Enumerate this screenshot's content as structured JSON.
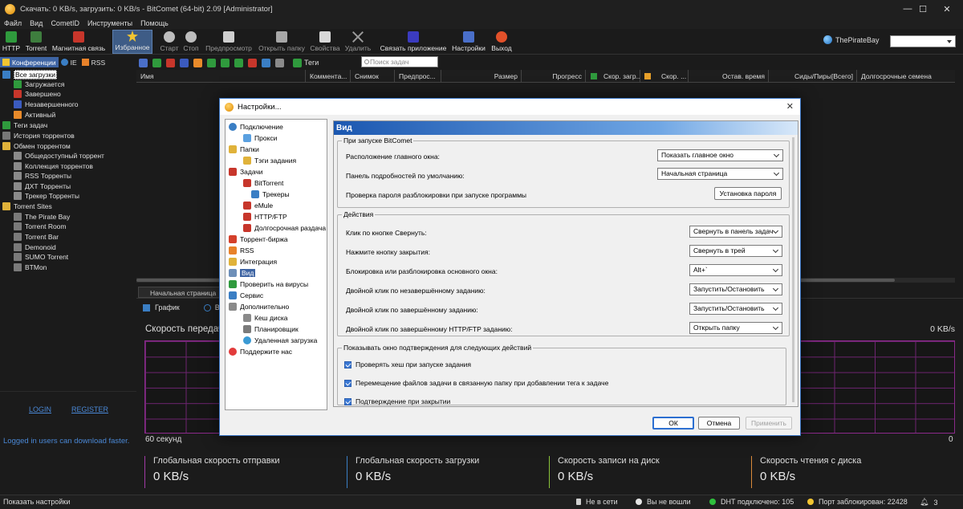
{
  "window": {
    "title": "Скачать: 0 KB/s, загрузить: 0 KB/s - BitComet (64-bit) 2.09 [Administrator]"
  },
  "menu": [
    "Файл",
    "Вид",
    "CometID",
    "Инструменты",
    "Помощь"
  ],
  "toolbar": {
    "http": "HTTP",
    "torrent": "Torrent",
    "magnet": "Магнитная связь",
    "favorites": "Избранное",
    "start": "Старт",
    "stop": "Стоп",
    "preview": "Предпросмотр",
    "open_folder": "Открыть папку",
    "properties": "Свойства",
    "delete": "Удалить",
    "link_app": "Связать приложение",
    "settings": "Настройки",
    "exit": "Выход",
    "site": "ThePirateBay"
  },
  "left_tabs": [
    "Конференции",
    "IE",
    "RSS"
  ],
  "tree": {
    "all": "Все загрузки",
    "downloading": "Загружается",
    "completed": "Завершено",
    "incomplete": "Незавершенного",
    "active": "Активный",
    "tags": "Теги задач",
    "history": "История торрентов",
    "exchange": "Обмен торрентом",
    "public": "Общедоступный торрент",
    "collection": "Коллекция торрентов",
    "rss": "RSS Торренты",
    "dht": "ДХТ Торренты",
    "tracker": "Трекер Торренты",
    "sites": "Torrent Sites",
    "piratebay": "The Pirate Bay",
    "room": "Torrent Room",
    "bar": "Torrent Bar",
    "demonoid": "Demonoid",
    "sumo": "SUMO Torrent",
    "btmon": "BTMon"
  },
  "left_bottom": {
    "login": "LOGIN",
    "register": "REGISTER",
    "note": "Logged in users can download faster."
  },
  "task_tools": {
    "tags": "Теги",
    "search_placeholder": "Поиск задач"
  },
  "columns": [
    "Имя",
    "Коммента...",
    "Снимок",
    "Предпрос...",
    "Размер",
    "Прогресс",
    "Скор. загр...",
    "Скор. ...",
    "Остав. время",
    "Сиды/Пиры[Всего]",
    "Долгосрочные семена"
  ],
  "bottom_tabs": {
    "start_page": "Начальная страница",
    "graph": "График",
    "b_label": "В"
  },
  "graph": {
    "speed_label": "Скорость передачи",
    "speed_value": "0 KB/s",
    "x_left": "60 секунд",
    "x_right": "0"
  },
  "stats": [
    {
      "label": "Глобальная скорость отправки",
      "value": "0 KB/s",
      "color": "#a13aa6"
    },
    {
      "label": "Глобальная скорость загрузки",
      "value": "0 KB/s",
      "color": "#3a7ec4"
    },
    {
      "label": "Скорость записи на диск",
      "value": "0 KB/s",
      "color": "#8ac43a"
    },
    {
      "label": "Скорость чтения с диска",
      "value": "0 KB/s",
      "color": "#d98a3a"
    }
  ],
  "statusbar": {
    "left": "Показать настройки",
    "network": "Не в сети",
    "login": "Вы не вошли",
    "dht": "DHT подключено: 105",
    "port": "Порт заблокирован: 22428",
    "notif": "3"
  },
  "dialog": {
    "title": "Настройки...",
    "nav": {
      "connection": "Подключение",
      "proxy": "Прокси",
      "folders": "Папки",
      "tag_tasks": "Тэги задания",
      "tasks": "Задачи",
      "bittorrent": "BitTorrent",
      "trackers": "Трекеры",
      "emule": "eMule",
      "httpftp": "HTTP/FTP",
      "longterm": "Долгосрочная раздача",
      "exchange": "Торрент-биржа",
      "rss": "RSS",
      "integration": "Интеграция",
      "view": "Вид",
      "virus": "Проверить на вирусы",
      "service": "Сервис",
      "advanced": "Дополнительно",
      "cache": "Кеш диска",
      "scheduler": "Планировщик",
      "remote": "Удаленная загрузка",
      "support": "Поддержите нас"
    },
    "panel_title": "Вид",
    "startup": {
      "group": "При запуске BitComet",
      "main_window_label": "Расположение главного окна:",
      "main_window_value": "Показать главное окно",
      "details_label": "Панель подробностей по умолчанию:",
      "details_value": "Начальная страница",
      "password_label": "Проверка пароля разблокировки при запуске программы",
      "password_button": "Установка пароля"
    },
    "actions": {
      "group": "Действия",
      "minimize_label": "Клик по кнопке Свернуть:",
      "minimize_value": "Свернуть в панель задач",
      "close_label": "Нажмите кнопку закрытия:",
      "close_value": "Свернуть в трей",
      "lock_label": "Блокировка или разблокировка основного окна:",
      "lock_value": "Alt+`",
      "dbl_incomplete_label": "Двойной клик по незавершённому заданию:",
      "dbl_incomplete_value": "Запустить/Остановить",
      "dbl_complete_label": "Двойной клик по завершённому заданию:",
      "dbl_complete_value": "Запустить/Остановить",
      "dbl_http_label": "Двойной клик по завершённому HTTP/FTP заданию:",
      "dbl_http_value": "Открыть папку"
    },
    "confirm": {
      "group": "Показывать окно подтверждения для следующих действий",
      "hash": "Проверять хеш при запуске задания",
      "move": "Перемещение файлов задачи в связанную папку при добавлении тега к задаче",
      "close": "Подтверждение при закрытии"
    },
    "buttons": {
      "ok": "ОК",
      "cancel": "Отмена",
      "apply": "Применить"
    }
  }
}
